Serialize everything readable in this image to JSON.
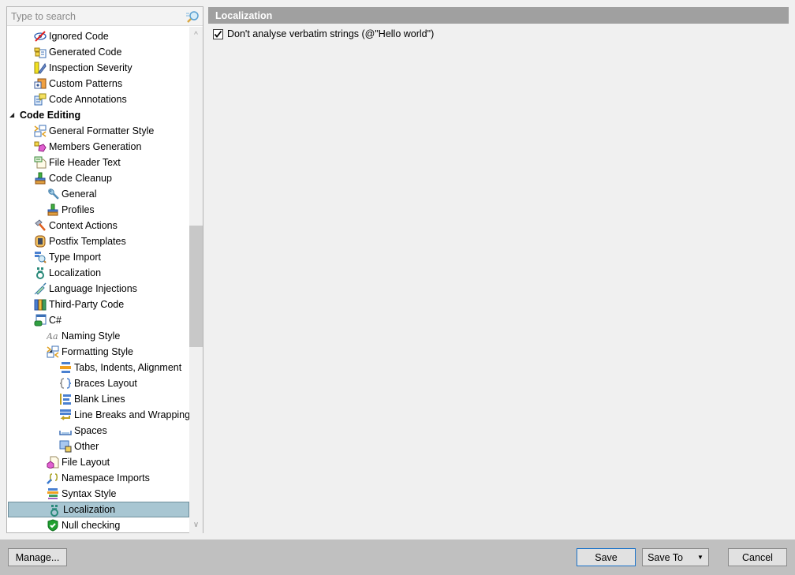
{
  "search": {
    "placeholder": "Type to search",
    "value": ""
  },
  "tree": {
    "items": [
      {
        "label": "Ignored Code",
        "level": 1,
        "icon": "ignored-code-icon",
        "expander": null
      },
      {
        "label": "Generated Code",
        "level": 1,
        "icon": "generated-code-icon",
        "expander": null
      },
      {
        "label": "Inspection Severity",
        "level": 1,
        "icon": "inspection-severity-icon",
        "expander": null
      },
      {
        "label": "Custom Patterns",
        "level": 1,
        "icon": "custom-patterns-icon",
        "expander": null
      },
      {
        "label": "Code Annotations",
        "level": 1,
        "icon": "code-annotations-icon",
        "expander": null
      },
      {
        "label": "Code Editing",
        "level": 0,
        "icon": null,
        "expander": "expanded",
        "bold": true
      },
      {
        "label": "General Formatter Style",
        "level": 1,
        "icon": "formatter-style-icon",
        "expander": null
      },
      {
        "label": "Members Generation",
        "level": 1,
        "icon": "members-generation-icon",
        "expander": null
      },
      {
        "label": "File Header Text",
        "level": 1,
        "icon": "file-header-icon",
        "expander": null
      },
      {
        "label": "Code Cleanup",
        "level": 1,
        "icon": "code-cleanup-icon",
        "expander": "expanded"
      },
      {
        "label": "General",
        "level": 2,
        "icon": "wrench-icon",
        "expander": null
      },
      {
        "label": "Profiles",
        "level": 2,
        "icon": "code-cleanup-icon",
        "expander": null
      },
      {
        "label": "Context Actions",
        "level": 1,
        "icon": "hammer-icon",
        "expander": null
      },
      {
        "label": "Postfix Templates",
        "level": 1,
        "icon": "postfix-templates-icon",
        "expander": null
      },
      {
        "label": "Type Import",
        "level": 1,
        "icon": "type-import-icon",
        "expander": null
      },
      {
        "label": "Localization",
        "level": 1,
        "icon": "localization-icon",
        "expander": null
      },
      {
        "label": "Language Injections",
        "level": 1,
        "icon": "syringe-icon",
        "expander": null
      },
      {
        "label": "Third-Party Code",
        "level": 1,
        "icon": "third-party-code-icon",
        "expander": null
      },
      {
        "label": "C#",
        "level": 1,
        "icon": "csharp-icon",
        "expander": "expanded"
      },
      {
        "label": "Naming Style",
        "level": 2,
        "icon": "naming-style-icon",
        "expander": null
      },
      {
        "label": "Formatting Style",
        "level": 2,
        "icon": "formatter-style-icon",
        "expander": "expanded"
      },
      {
        "label": "Tabs, Indents, Alignment",
        "level": 3,
        "icon": "tabs-indents-icon",
        "expander": null
      },
      {
        "label": "Braces Layout",
        "level": 3,
        "icon": "braces-layout-icon",
        "expander": null
      },
      {
        "label": "Blank Lines",
        "level": 3,
        "icon": "blank-lines-icon",
        "expander": null
      },
      {
        "label": "Line Breaks and Wrapping",
        "level": 3,
        "icon": "line-breaks-icon",
        "expander": null
      },
      {
        "label": "Spaces",
        "level": 3,
        "icon": "spaces-icon",
        "expander": null
      },
      {
        "label": "Other",
        "level": 3,
        "icon": "other-icon",
        "expander": null
      },
      {
        "label": "File Layout",
        "level": 2,
        "icon": "file-layout-icon",
        "expander": null
      },
      {
        "label": "Namespace Imports",
        "level": 2,
        "icon": "namespace-imports-icon",
        "expander": null
      },
      {
        "label": "Syntax Style",
        "level": 2,
        "icon": "syntax-style-icon",
        "expander": null
      },
      {
        "label": "Localization",
        "level": 2,
        "icon": "localization-icon",
        "expander": null,
        "selected": true
      },
      {
        "label": "Null checking",
        "level": 2,
        "icon": "null-checking-icon",
        "expander": null
      }
    ]
  },
  "panel": {
    "title": "Localization",
    "options": [
      {
        "label": "Don't analyse verbatim strings (@\"Hello world\")",
        "checked": true
      }
    ]
  },
  "footer": {
    "manage_label": "Manage...",
    "save_label": "Save",
    "save_to_label": "Save To",
    "cancel_label": "Cancel"
  },
  "colors": {
    "header_bg": "#a0a0a0",
    "selected_row_bg": "#a8c6d2",
    "footer_bg": "#c0c0c0",
    "default_button_border": "#1a72c9"
  }
}
